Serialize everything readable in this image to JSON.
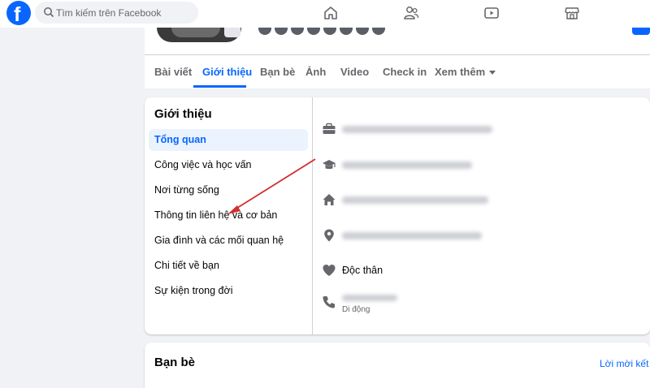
{
  "topbar": {
    "logo_letter": "f",
    "search_placeholder": "Tìm kiếm trên Facebook",
    "nav_icons": [
      "home-icon",
      "friends-icon",
      "watch-icon",
      "marketplace-icon"
    ]
  },
  "profile_tabs": [
    {
      "label": "Bài viết",
      "active": false
    },
    {
      "label": "Giới thiệu",
      "active": true
    },
    {
      "label": "Bạn bè",
      "active": false
    },
    {
      "label": "Ảnh",
      "active": false
    },
    {
      "label": "Video",
      "active": false
    },
    {
      "label": "Check in",
      "active": false
    },
    {
      "label": "Xem thêm",
      "active": false
    }
  ],
  "intro": {
    "title": "Giới thiệu",
    "menu": [
      {
        "label": "Tổng quan",
        "active": true
      },
      {
        "label": "Công việc và học vấn",
        "active": false
      },
      {
        "label": "Nơi từng sống",
        "active": false
      },
      {
        "label": "Thông tin liên hệ và cơ bản",
        "active": false
      },
      {
        "label": "Gia đình và các mối quan hệ",
        "active": false
      },
      {
        "label": "Chi tiết về bạn",
        "active": false
      },
      {
        "label": "Sự kiện trong đời",
        "active": false
      }
    ],
    "details": [
      {
        "icon": "briefcase-icon",
        "text": ""
      },
      {
        "icon": "graduation-cap-icon",
        "text": ""
      },
      {
        "icon": "home-icon",
        "text": ""
      },
      {
        "icon": "location-pin-icon",
        "text": ""
      },
      {
        "icon": "heart-icon",
        "text": "Độc thân"
      },
      {
        "icon": "phone-icon",
        "text": "",
        "sub": "Di động"
      }
    ]
  },
  "friends": {
    "title": "Bạn bè",
    "link": "Lời mời kết b"
  },
  "colors": {
    "brand": "#0866ff",
    "background": "#f0f2f5",
    "annotation_arrow": "#d32f2f"
  }
}
